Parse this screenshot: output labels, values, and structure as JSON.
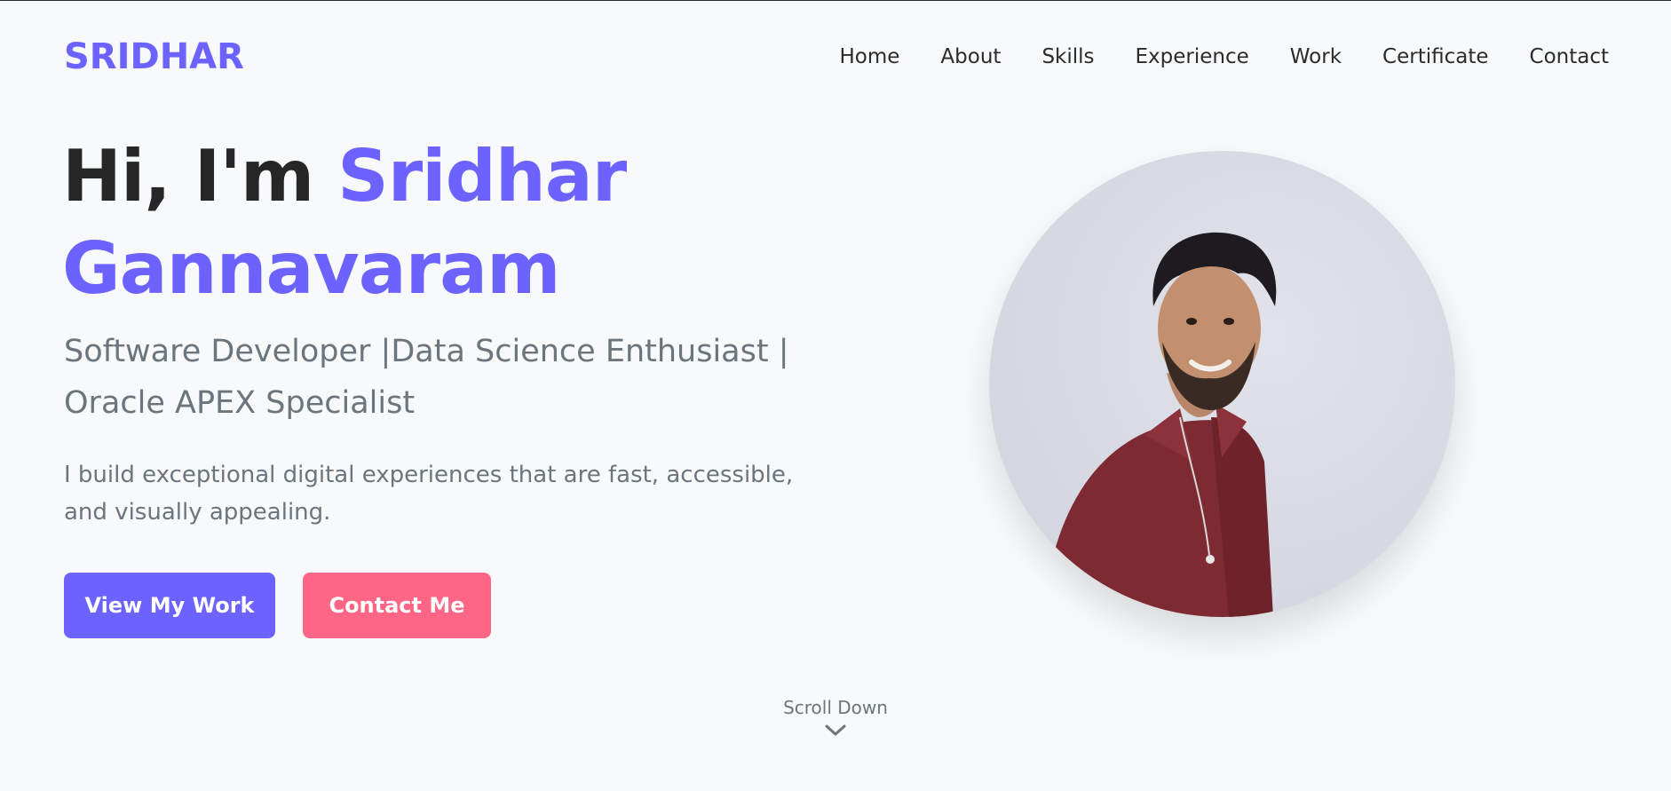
{
  "header": {
    "logo": "SRIDHAR",
    "nav": [
      "Home",
      "About",
      "Skills",
      "Experience",
      "Work",
      "Certificate",
      "Contact"
    ]
  },
  "hero": {
    "greeting": "Hi, I'm ",
    "name_first": "Sridhar",
    "name_last": "Gannavaram",
    "subtitle_line1": "Software Developer |Data Science Enthusiast |",
    "subtitle_line2": "Oracle APEX Specialist",
    "description": "I build exceptional digital experiences that are fast, accessible, and visually appealing.",
    "primary_button": "View My Work",
    "secondary_button": "Contact Me"
  },
  "profile": {
    "icon": "profile-photo"
  },
  "scroll": {
    "label": "Scroll Down",
    "icon": "chevron-down-icon"
  },
  "colors": {
    "accent": "#6c63ff",
    "secondary": "#ff6584",
    "text_dark": "#262626",
    "text_muted": "#6c757d",
    "background": "#f8f9fa"
  }
}
